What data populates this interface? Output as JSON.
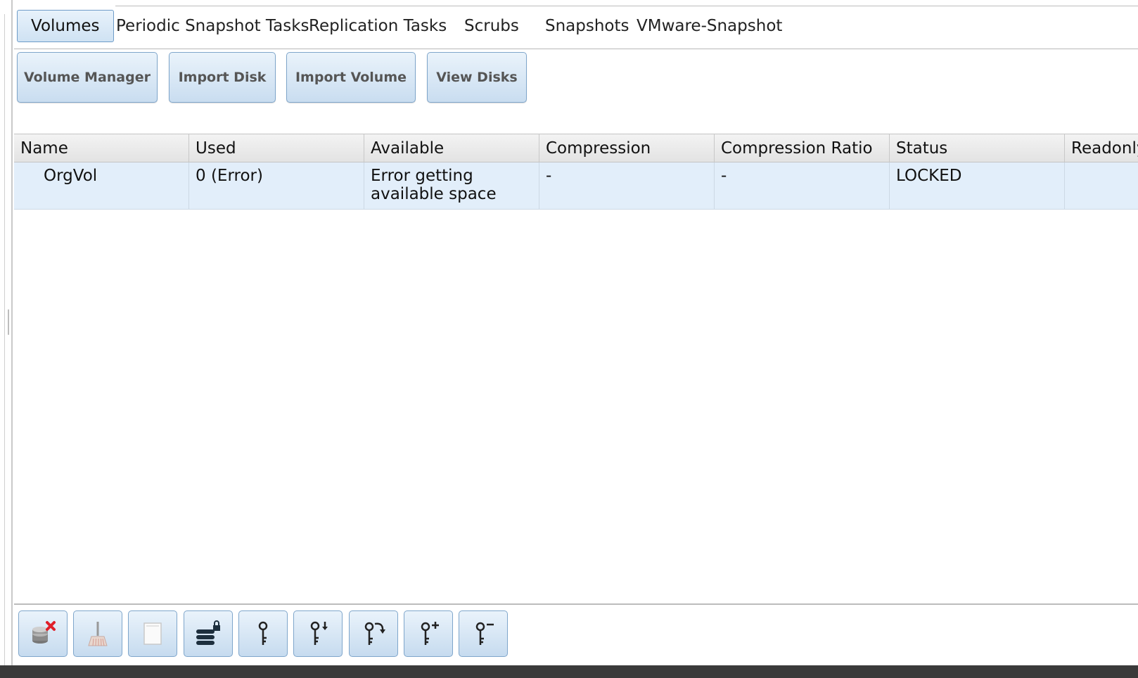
{
  "tabs": [
    {
      "label": "Volumes",
      "active": true
    },
    {
      "label": "Periodic Snapshot Tasks",
      "active": false
    },
    {
      "label": "Replication Tasks",
      "active": false
    },
    {
      "label": "Scrubs",
      "active": false
    },
    {
      "label": "Snapshots",
      "active": false
    },
    {
      "label": "VMware-Snapshot",
      "active": false
    }
  ],
  "actions": {
    "volume_manager": "Volume Manager",
    "import_disk": "Import Disk",
    "import_volume": "Import Volume",
    "view_disks": "View Disks"
  },
  "table": {
    "columns": [
      "Name",
      "Used",
      "Available",
      "Compression",
      "Compression Ratio",
      "Status",
      "Readonly"
    ],
    "rows": [
      {
        "name": "OrgVol",
        "used": "0 (Error)",
        "available": "Error getting available space",
        "compression": "-",
        "compression_ratio": "-",
        "status": "LOCKED",
        "readonly": ""
      }
    ]
  },
  "toolbar_icons": [
    "detach-volume-icon",
    "scrub-icon",
    "edit-icon",
    "unlock-icon",
    "key-icon",
    "download-key-icon",
    "change-passphrase-icon",
    "add-recovery-key-icon",
    "remove-recovery-key-icon"
  ],
  "colors": {
    "accent_border": "#7fa6cb",
    "selected_row": "#e2eefa",
    "detach_x": "#e0202a"
  }
}
